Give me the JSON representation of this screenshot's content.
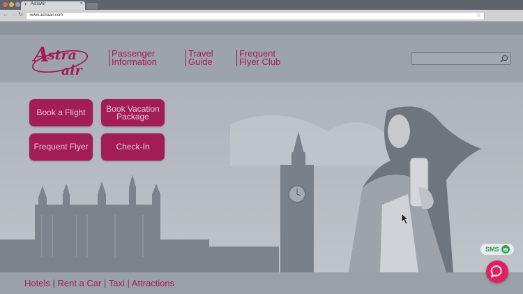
{
  "browser": {
    "tab_title": "AstraAir",
    "url": "www.astraair.com"
  },
  "header": {
    "logo_text": "Astra air",
    "nav": [
      {
        "line1": "Passenger",
        "line2": "Information"
      },
      {
        "line1": "Travel",
        "line2": "Guide"
      },
      {
        "line1": "Frequent",
        "line2": "Flyer Club"
      }
    ],
    "search_placeholder": ""
  },
  "hero": {
    "buttons": [
      {
        "line1": "Book a Flight",
        "line2": ""
      },
      {
        "line1": "Book Vacation",
        "line2": "Package"
      },
      {
        "line1": "Frequent Flyer",
        "line2": ""
      },
      {
        "line1": "Check-In",
        "line2": ""
      }
    ]
  },
  "footer": {
    "links": [
      "Hotels",
      "Rent a Car",
      "Taxi",
      "Attractions"
    ],
    "separator": " | "
  },
  "widgets": {
    "sms_label": "SMS"
  },
  "colors": {
    "brand": "#a41c55",
    "button_bg": "#a31d55",
    "chat": "#e2205e",
    "sms_green": "#2fa34f",
    "page_overlay": "#9ba1ab"
  },
  "icons": [
    "close-icon",
    "back-icon",
    "forward-icon",
    "reload-icon",
    "star-icon",
    "search-icon",
    "sms-icon",
    "chat-icon",
    "cursor-icon"
  ]
}
